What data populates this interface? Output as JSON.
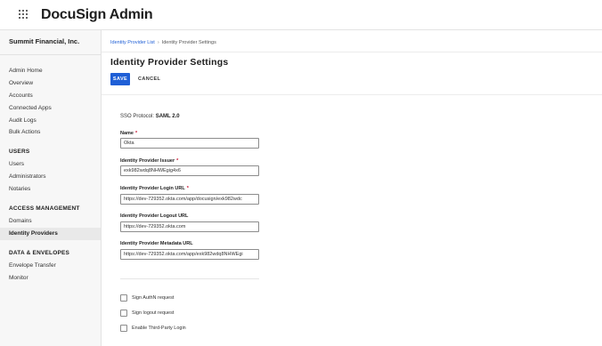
{
  "app": {
    "title": "DocuSign Admin"
  },
  "sidebar": {
    "org_name": "Summit Financial, Inc.",
    "items_top": [
      {
        "label": "Admin Home"
      },
      {
        "label": "Overview"
      },
      {
        "label": "Accounts"
      },
      {
        "label": "Connected Apps"
      },
      {
        "label": "Audit Logs"
      },
      {
        "label": "Bulk Actions"
      }
    ],
    "users_header": "USERS",
    "items_users": [
      {
        "label": "Users"
      },
      {
        "label": "Administrators"
      },
      {
        "label": "Notaries"
      }
    ],
    "access_header": "ACCESS MANAGEMENT",
    "items_access": [
      {
        "label": "Domains"
      },
      {
        "label": "Identity Providers"
      }
    ],
    "data_header": "DATA & ENVELOPES",
    "items_data": [
      {
        "label": "Envelope Transfer"
      },
      {
        "label": "Monitor"
      }
    ]
  },
  "breadcrumb": {
    "parent": "Identity Provider List",
    "separator": "›",
    "current": "Identity Provider Settings"
  },
  "page": {
    "title": "Identity Provider Settings",
    "save_label": "SAVE",
    "cancel_label": "CANCEL"
  },
  "form": {
    "sso_prefix": "SSO Protocol:",
    "sso_value": "SAML 2.0",
    "required_mark": "*",
    "name_label": "Name",
    "name_value": "Okta",
    "issuer_label": "Identity Provider Issuer",
    "issuer_value": "exk982wdq8NHWEgig4x6",
    "login_url_label": "Identity Provider Login URL",
    "login_url_value": "https://dev-729352.okta.com/app/docusign/exk982wdc",
    "logout_url_label": "Identity Provider Logout URL",
    "logout_url_value": "https://dev-729352.okta.com",
    "metadata_url_label": "Identity Provider Metadata URL",
    "metadata_url_value": "https://dev-729352.okta.com/app/exk982wdq8NHWEgi",
    "checkboxes": [
      {
        "label": "Sign AuthN request"
      },
      {
        "label": "Sign logout request"
      },
      {
        "label": "Enable Third-Party Login"
      }
    ]
  },
  "colors": {
    "accent": "#1f5fd6",
    "required": "#c8102e"
  }
}
